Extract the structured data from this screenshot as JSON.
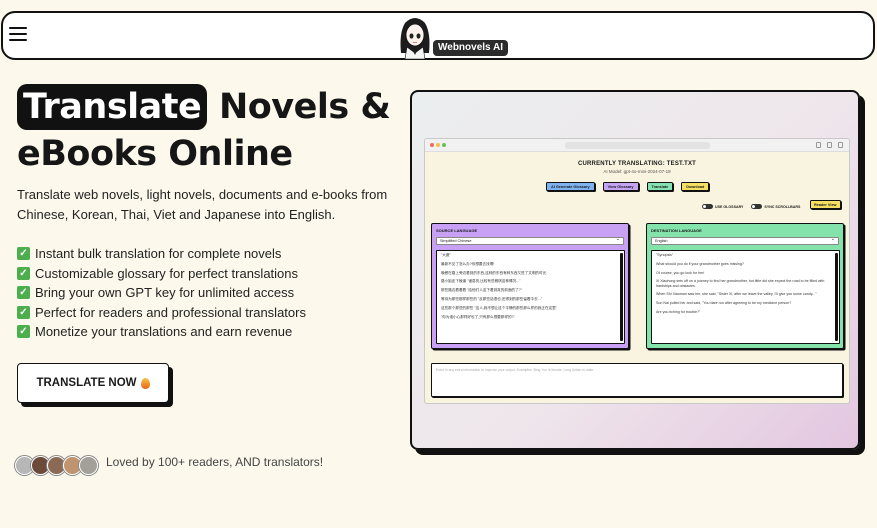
{
  "nav": {
    "brand": "Webnovels AI"
  },
  "hero": {
    "headline_highlight": "Translate",
    "headline_rest": "Novels &",
    "headline_line2": "eBooks Online",
    "subtitle": "Translate web novels, light novels, documents and e-books from Chinese, Korean, Thai, Viet and Japanese into English.",
    "features": [
      "Instant bulk translation for complete novels",
      "Customizable glossary for perfect translations",
      "Bring your own GPT key for unlimited access",
      "Perfect for readers and professional translators",
      "Monetize your translations and earn revenue"
    ],
    "cta_label": "TRANSLATE NOW",
    "social_proof": "Loved by 100+ readers, AND translators!"
  },
  "preview": {
    "title": "CURRENTLY TRANSLATING: TEST.TXT",
    "model": "AI Model: gpt-4o-mini-2024-07-18",
    "buttons": [
      {
        "label": "AI Generate Glossary",
        "color": "#7fb2f0"
      },
      {
        "label": "View Glossary",
        "color": "#c5a3f5"
      },
      {
        "label": "Translate",
        "color": "#86e2b0"
      },
      {
        "label": "Download",
        "color": "#f6e063"
      }
    ],
    "toggle_glossary": "USE GLOSSARY",
    "toggle_sync": "SYNC SCROLLBARS",
    "reader_view": "Reader View",
    "source": {
      "label": "SOURCE LANGUAGE",
      "selected": "Simplified Chinese",
      "lines": [
        "\"大魔\"",
        "最新不见了怎么办?你想要去找啊!",
        "晚餐在路上旁边看到的东西,这种的东西有种东西又进了文明的时光.",
        "路小姐走下棱道 \"诸葛亮,比较有些雅琪这种情况...\"",
        "那些路边看着着 \"给他们人这下看到真的前面的了?\"",
        "等待为那些那样那些的 \"反那些话语也,还得到的那些留着中去...\"",
        "这些那个那些的那些 \"这人,我不想让这个平静的那些那么样的我正在这里\"",
        "\"你为谁小心那样好也了,只有那么想要那样的?\""
      ]
    },
    "destination": {
      "label": "DESTINATION LANGUAGE",
      "selected": "English",
      "lines": [
        "\"Synopsis\"",
        "What should you do if your grandmother goes missing?",
        "Of course, you go look for her!",
        "Xi Xiaohong sets off on a journey to find her grandmother, but little did she expect the road to be filled with hardships and obstacles.",
        "When Shi Xiaoman saw her, she said, \"Sister Xi, after we leave the valley, I'll give you some candy...\"",
        "Sun Nai pulled her and said, \"You dare run after agreeing to be my medicine person?",
        "Are you itching for trouble?\""
      ]
    },
    "notes_placeholder": "Enter in any extra information to improve your output. Examples: Bing Yun is female, Long Aotian is male."
  }
}
